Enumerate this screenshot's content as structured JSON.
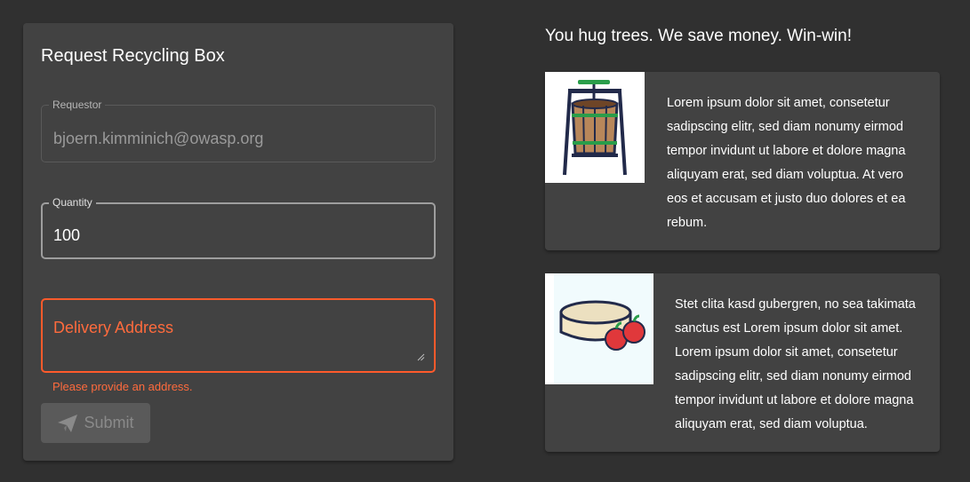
{
  "form": {
    "title": "Request Recycling Box",
    "requestor_label": "Requestor",
    "requestor_value": "bjoern.kimminich@owasp.org",
    "quantity_label": "Quantity",
    "quantity_value": "100",
    "address_placeholder": "Delivery Address",
    "address_error": "Please provide an address.",
    "submit_label": "Submit"
  },
  "info": {
    "tagline": "You hug trees. We save money. Win-win!",
    "card1_text": "Lorem ipsum dolor sit amet, consetetur sadipscing elitr, sed diam nonumy eirmod tempor invidunt ut labore et dolore magna aliquyam erat, sed diam voluptua. At vero eos et accusam et justo duo dolores et ea rebum.",
    "card2_text": "Stet clita kasd gubergren, no sea takimata sanctus est Lorem ipsum dolor sit amet. Lorem ipsum dolor sit amet, consetetur sadipscing elitr, sed diam nonumy eirmod tempor invidunt ut labore et dolore magna aliquyam erat, sed diam voluptua."
  },
  "colors": {
    "background": "#303030",
    "card": "#424242",
    "error": "#ff5a2b"
  },
  "icons": {
    "submit": "send-icon",
    "card1_image": "fruit-press-icon",
    "card2_image": "apple-pomace-icon"
  }
}
